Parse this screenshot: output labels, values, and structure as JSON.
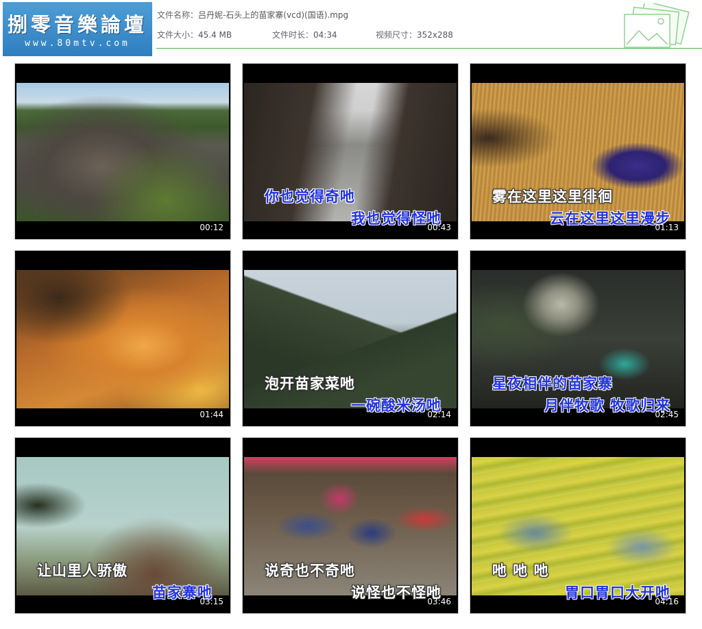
{
  "logo": {
    "title": "捌零音樂論壇",
    "url": "www.80mtv.com"
  },
  "file_info": {
    "name_label": "文件名称：",
    "name": "吕丹妮-石头上的苗家寨(vcd)(国语).mpg",
    "size_label": "文件大小：",
    "size": "45.4 MB",
    "duration_label": "文件时长：",
    "duration": "04:34",
    "resolution_label": "视频尺寸：",
    "resolution": "352x288"
  },
  "thumbnails": [
    {
      "time": "00:12",
      "line1": "",
      "line2": ""
    },
    {
      "time": "00:43",
      "line1": "你也觉得奇吔",
      "line2": "我也觉得怪吔"
    },
    {
      "time": "01:13",
      "line1": "雾在这里这里徘徊",
      "line2": "云在这里这里漫步"
    },
    {
      "time": "01:44",
      "line1": "",
      "line2": ""
    },
    {
      "time": "02:14",
      "line1": "泡开苗家菜吔",
      "line2": "一碗酸米汤吔"
    },
    {
      "time": "02:45",
      "line1": "星夜相伴的苗家寨",
      "line2": "月伴牧歌 牧歌归来"
    },
    {
      "time": "03:15",
      "line1": "让山里人骄傲",
      "line2": "苗家寨吔"
    },
    {
      "time": "03:46",
      "line1": "说奇也不奇吔",
      "line2": "说怪也不怪吔"
    },
    {
      "time": "04:16",
      "line1": "吔 吔 吔",
      "line2": "胃口胃口大开吔"
    }
  ]
}
